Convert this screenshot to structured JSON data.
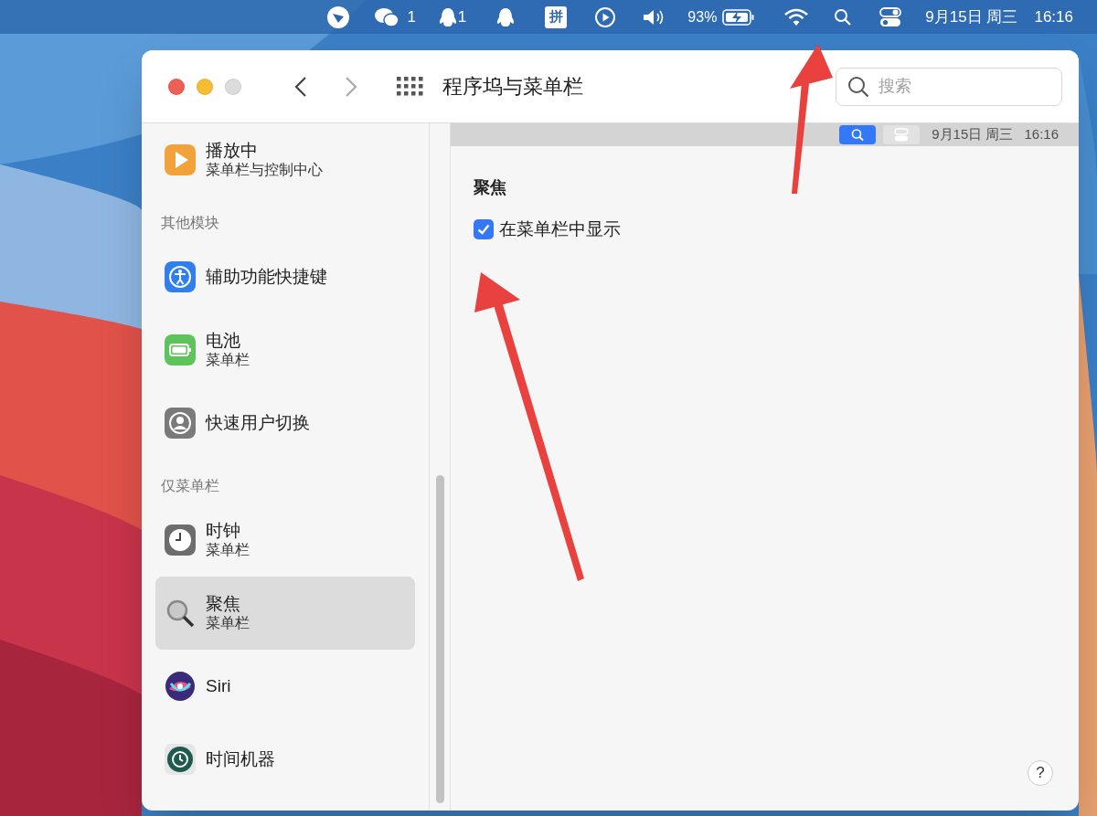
{
  "menu_bar": {
    "wechat_count": "1",
    "qq_count": "1",
    "input_method": "拼",
    "battery": "93%",
    "date": "9月15日 周三",
    "time": "16:16"
  },
  "window": {
    "title": "程序坞与菜单栏",
    "search": {
      "placeholder": "搜索"
    }
  },
  "sidebar": {
    "items": [
      {
        "kind": "item",
        "title": "播放中",
        "subtitle": "菜单栏与控制中心",
        "selected": false
      },
      {
        "kind": "header",
        "title": "其他模块"
      },
      {
        "kind": "item",
        "title": "辅助功能快捷键",
        "selected": false
      },
      {
        "kind": "item",
        "title": "电池",
        "subtitle": "菜单栏",
        "selected": false
      },
      {
        "kind": "item",
        "title": "快速用户切换",
        "selected": false
      },
      {
        "kind": "header",
        "title": "仅菜单栏"
      },
      {
        "kind": "item",
        "title": "时钟",
        "subtitle": "菜单栏",
        "selected": false
      },
      {
        "kind": "item",
        "title": "聚焦",
        "subtitle": "菜单栏",
        "selected": true
      },
      {
        "kind": "item",
        "title": "Siri",
        "selected": false
      },
      {
        "kind": "item",
        "title": "时间机器",
        "selected": false
      }
    ]
  },
  "preview_bar": {
    "date": "9月15日 周三",
    "time": "16:16"
  },
  "content": {
    "section_title": "聚焦",
    "checkbox": {
      "label": "在菜单栏中显示",
      "checked": true
    }
  },
  "help_button": "?"
}
